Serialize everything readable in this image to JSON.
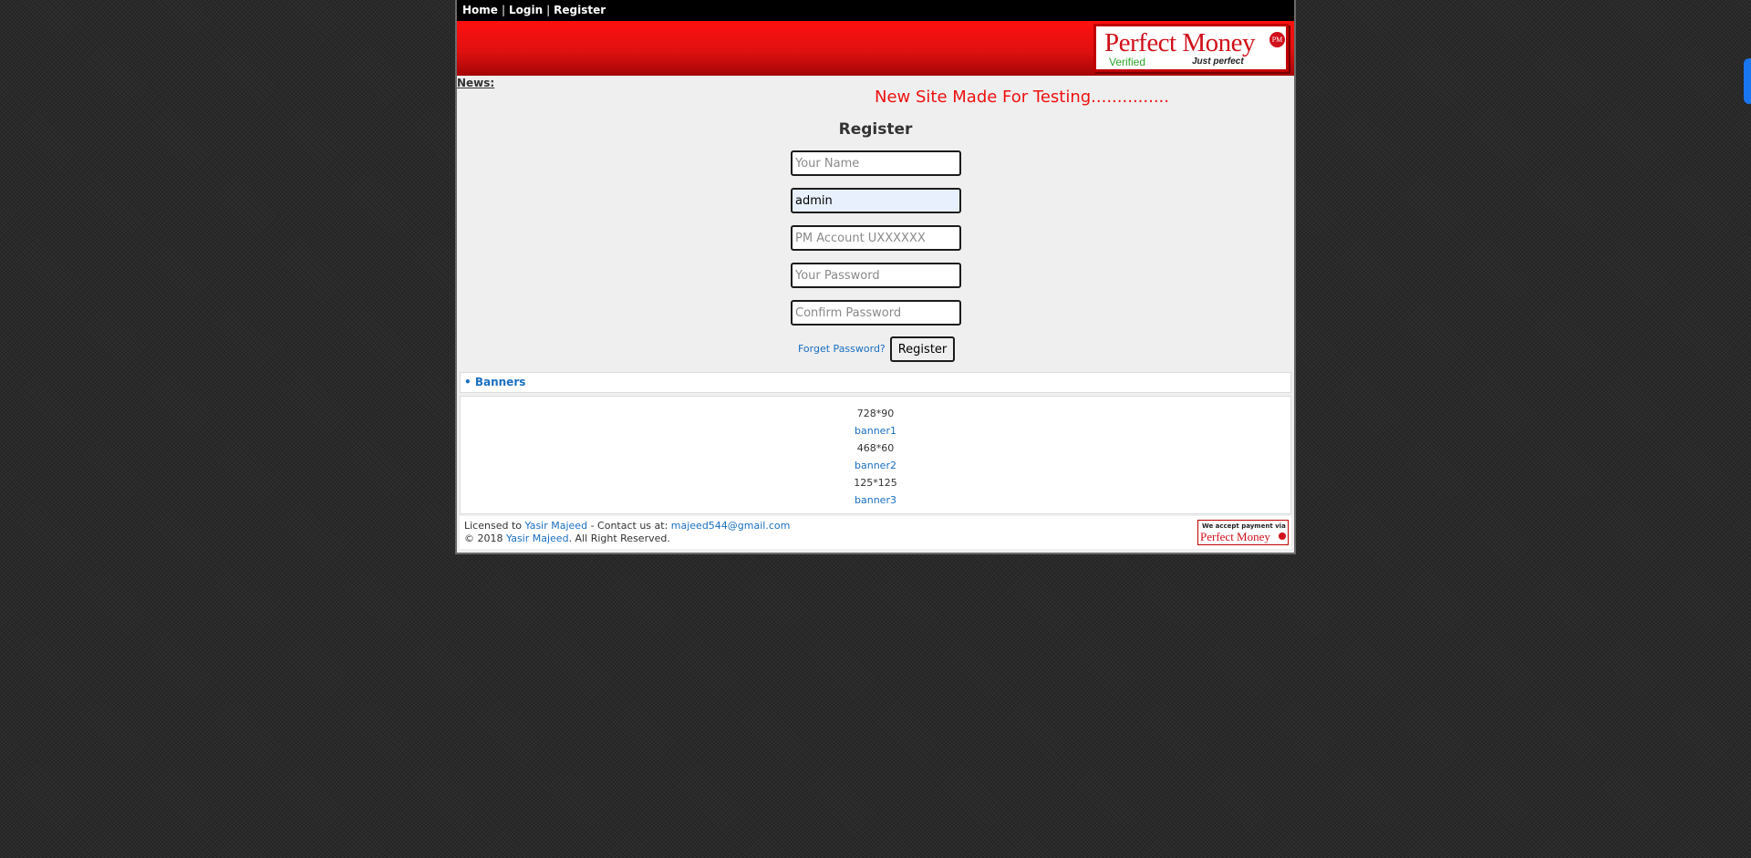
{
  "nav": {
    "items": [
      "Home",
      "Login",
      "Register"
    ],
    "separator": "|"
  },
  "logo": {
    "title": "Perfect Money",
    "badge": "PM",
    "verified": "Verified",
    "tagline": "Just perfect"
  },
  "news": {
    "label": "News:",
    "text": "New Site Made For Testing..............."
  },
  "form": {
    "title": "Register",
    "fields": [
      {
        "placeholder": "Your Name",
        "value": ""
      },
      {
        "placeholder": "",
        "value": "admin"
      },
      {
        "placeholder": "PM Account UXXXXXX",
        "value": ""
      },
      {
        "placeholder": "Your Password",
        "value": ""
      },
      {
        "placeholder": "Confirm Password",
        "value": ""
      }
    ],
    "forget_link": "Forget Password?",
    "submit_label": "Register"
  },
  "banners": {
    "heading": "• Banners",
    "items": [
      {
        "size": "728*90",
        "link": "banner1"
      },
      {
        "size": "468*60",
        "link": "banner2"
      },
      {
        "size": "125*125",
        "link": "banner3"
      }
    ]
  },
  "footer": {
    "licensed_prefix": "Licensed to",
    "licensed_name": "Yasir Majeed",
    "contact_prefix": "- Contact us at:",
    "email": "majeed544@gmail.com",
    "copyright_prefix": "© 2018",
    "copyright_name": "Yasir Majeed",
    "copyright_suffix": ". All Right Reserved.",
    "accept_badge_top": "We accept payment via",
    "accept_badge_brand": "Perfect Money"
  },
  "colors": {
    "header_red": "#e01010",
    "news_red": "#ee1111",
    "link_blue": "#1a6fc0",
    "nav_black": "#000000",
    "side_tab_blue": "#1976f0"
  },
  "icons": {
    "pm_badge": "pm-circle-icon",
    "banner_bullet": "bullet-icon"
  }
}
